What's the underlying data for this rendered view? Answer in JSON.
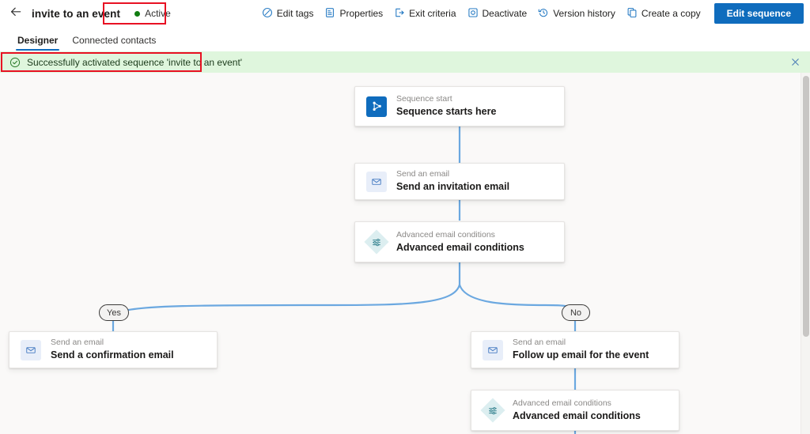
{
  "header": {
    "back_icon": "arrow-left-icon",
    "title": "invite to an event",
    "status": {
      "label": "Active",
      "dot_color": "#107c10"
    },
    "actions": [
      {
        "label": "Edit tags",
        "icon": "tag-icon"
      },
      {
        "label": "Properties",
        "icon": "properties-icon"
      },
      {
        "label": "Exit criteria",
        "icon": "exit-icon"
      },
      {
        "label": "Deactivate",
        "icon": "deactivate-icon"
      },
      {
        "label": "Version history",
        "icon": "history-icon"
      },
      {
        "label": "Create a copy",
        "icon": "copy-icon"
      }
    ],
    "primary_button": "Edit sequence"
  },
  "tabs": [
    {
      "label": "Designer",
      "active": true
    },
    {
      "label": "Connected contacts",
      "active": false
    }
  ],
  "notification": {
    "icon": "success-check-icon",
    "message": "Successfully activated sequence 'invite to an event'",
    "close_icon": "close-icon",
    "background": "#dff6dd"
  },
  "canvas": {
    "background": "#faf9f8",
    "connector_color": "#6ba8e0",
    "nodes": [
      {
        "id": "start",
        "icon": "sequence-start-icon",
        "subtitle": "Sequence start",
        "title": "Sequence starts here"
      },
      {
        "id": "invite-email",
        "icon": "email-icon",
        "subtitle": "Send an email",
        "title": "Send an invitation email"
      },
      {
        "id": "condition-1",
        "icon": "conditions-icon",
        "subtitle": "Advanced email conditions",
        "title": "Advanced email conditions"
      },
      {
        "id": "confirmation-email",
        "icon": "email-icon",
        "subtitle": "Send an email",
        "title": "Send a confirmation email"
      },
      {
        "id": "followup-email",
        "icon": "email-icon",
        "subtitle": "Send an email",
        "title": "Follow up email for the event"
      },
      {
        "id": "condition-2",
        "icon": "conditions-icon",
        "subtitle": "Advanced email conditions",
        "title": "Advanced email conditions"
      }
    ],
    "branch_labels": [
      {
        "id": "yes",
        "label": "Yes"
      },
      {
        "id": "no",
        "label": "No"
      }
    ]
  },
  "annotations": {
    "color": "#e81123",
    "boxes": [
      {
        "target": "status-chip"
      },
      {
        "target": "notification-bar"
      }
    ]
  }
}
